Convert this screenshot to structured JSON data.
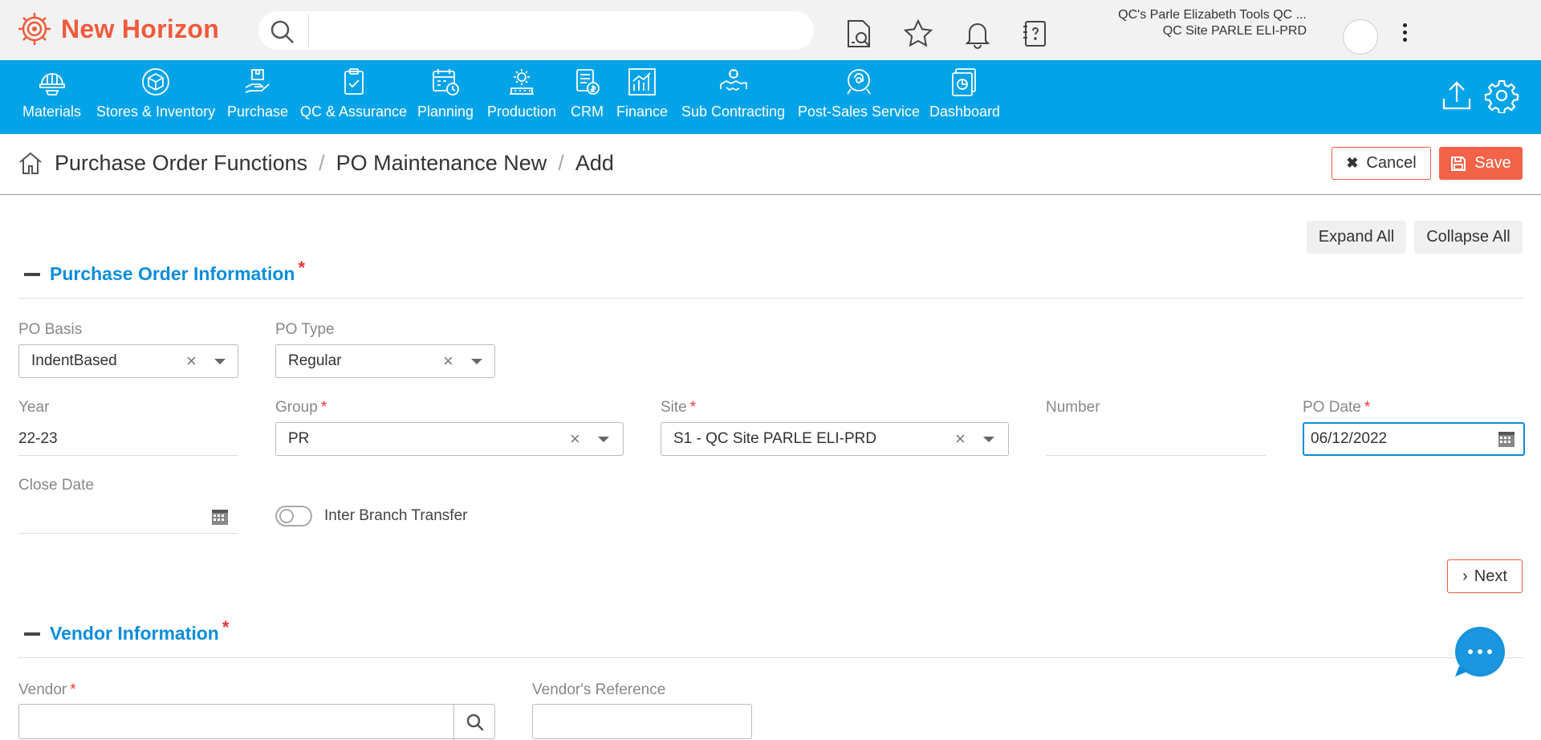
{
  "app": {
    "name": "New Horizon"
  },
  "search": {
    "placeholder": ""
  },
  "user": {
    "line1": "QC's Parle Elizabeth Tools QC ...",
    "line2": "QC Site PARLE ELI-PRD"
  },
  "nav": {
    "items": [
      {
        "label": "Materials",
        "icon": "helmet-icon"
      },
      {
        "label": "Stores & Inventory",
        "icon": "box-icon"
      },
      {
        "label": "Purchase",
        "icon": "hand-package-icon"
      },
      {
        "label": "QC & Assurance",
        "icon": "clipboard-check-icon"
      },
      {
        "label": "Planning",
        "icon": "calendar-clock-icon"
      },
      {
        "label": "Production",
        "icon": "factory-gear-icon"
      },
      {
        "label": "CRM",
        "icon": "crm-doc-icon"
      },
      {
        "label": "Finance",
        "icon": "bar-chart-icon"
      },
      {
        "label": "Sub Contracting",
        "icon": "handshake-icon"
      },
      {
        "label": "Post-Sales Service",
        "icon": "service-icon"
      },
      {
        "label": "Dashboard",
        "icon": "dashboard-icon"
      }
    ]
  },
  "breadcrumb": {
    "items": [
      "Purchase Order Functions",
      "PO Maintenance New",
      "Add"
    ]
  },
  "actions": {
    "cancel": "Cancel",
    "save": "Save",
    "expand_all": "Expand All",
    "collapse_all": "Collapse All",
    "next": "Next"
  },
  "po_info": {
    "title": "Purchase Order Information",
    "po_basis": {
      "label": "PO Basis",
      "value": "IndentBased"
    },
    "po_type": {
      "label": "PO Type",
      "value": "Regular"
    },
    "year": {
      "label": "Year",
      "value": "22-23"
    },
    "group": {
      "label": "Group",
      "value": "PR"
    },
    "site": {
      "label": "Site",
      "value": "S1 - QC Site PARLE ELI-PRD"
    },
    "number": {
      "label": "Number",
      "value": ""
    },
    "po_date": {
      "label": "PO Date",
      "value": "06/12/2022"
    },
    "close_date": {
      "label": "Close Date",
      "value": ""
    },
    "inter_branch": {
      "label": "Inter Branch Transfer",
      "enabled": false
    }
  },
  "vendor_info": {
    "title": "Vendor Information",
    "vendor": {
      "label": "Vendor",
      "value": ""
    },
    "vendor_ref": {
      "label": "Vendor's Reference",
      "value": ""
    }
  },
  "colors": {
    "brand": "#ef5a3c",
    "nav": "#03a3e8",
    "section": "#0b8ddb",
    "required": "#e33333"
  }
}
